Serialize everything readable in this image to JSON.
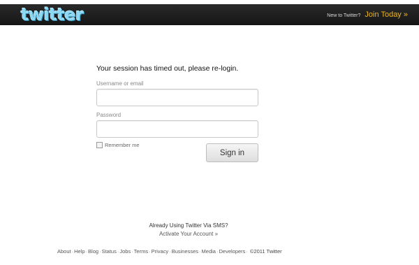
{
  "header": {
    "logo_text": "twitter",
    "new_to_text": "New to Twitter?",
    "join_label": "Join Today »"
  },
  "login": {
    "heading": "Your session has timed out, please re-login.",
    "username_label": "Username or email",
    "username_value": "",
    "password_label": "Password",
    "password_value": "",
    "remember_label": "Remember me",
    "signin_label": "Sign in"
  },
  "sms": {
    "question": "Already Using Twitter Via SMS?",
    "activate_label": "Activate Your Account »"
  },
  "footer": {
    "links": [
      "About",
      "Help",
      "Blog",
      "Status",
      "Jobs",
      "Terms",
      "Privacy",
      "Businesses",
      "Media",
      "Developers"
    ],
    "copyright": "©2011 Twitter"
  },
  "colors": {
    "topbar": "#1c1c1c",
    "logo": "#8fd8f2",
    "join_link": "#f0b51e"
  }
}
